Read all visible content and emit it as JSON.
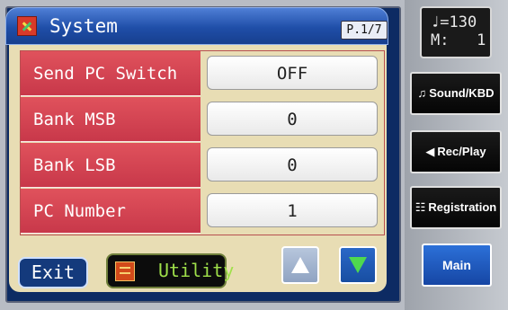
{
  "header": {
    "title": "System",
    "page_indicator": "P.1/7"
  },
  "parameters": [
    {
      "label": "Send PC Switch",
      "value": "OFF"
    },
    {
      "label": "Bank MSB",
      "value": "0"
    },
    {
      "label": "Bank LSB",
      "value": "0"
    },
    {
      "label": "PC Number",
      "value": "1"
    }
  ],
  "footer": {
    "exit_label": "Exit",
    "utility_label": "Utility"
  },
  "scroll": {
    "up_icon": "arrow-up-icon",
    "down_icon": "arrow-down-icon"
  },
  "status": {
    "tempo": "♩=130",
    "measure": "M:   1"
  },
  "side_menu": {
    "sound_kbd": "Sound/KBD",
    "rec_play": "Rec/Play",
    "registration": "Registration",
    "main": "Main"
  },
  "colors": {
    "label_bg": "#d6404f",
    "title_bar": "#1f4ea8",
    "panel_bg": "#e8ddb4",
    "utility_text": "#9fe04a",
    "main_button": "#1f5bc0"
  }
}
